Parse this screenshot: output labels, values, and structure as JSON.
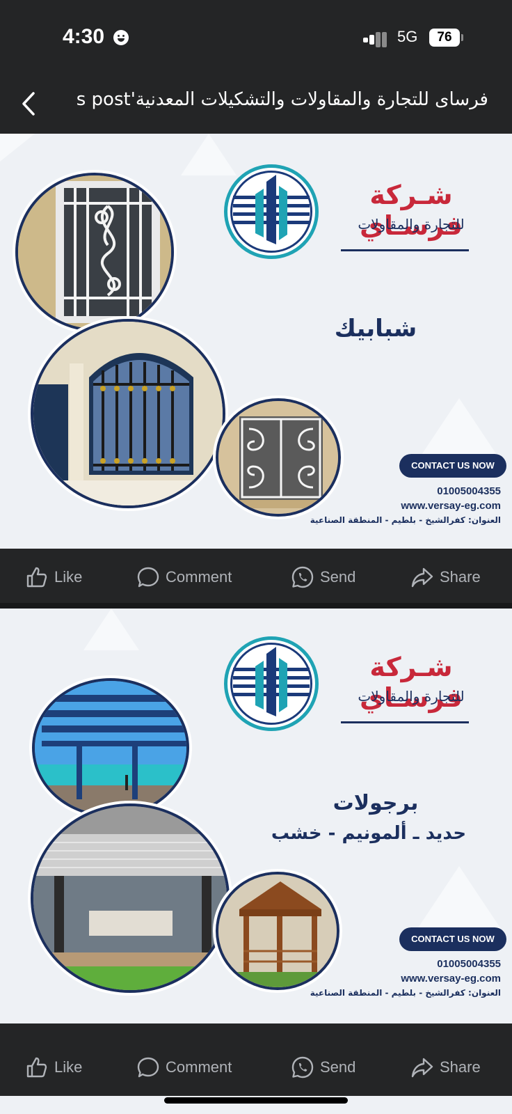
{
  "status_bar": {
    "time": "4:30",
    "network": "5G",
    "battery": "76"
  },
  "nav": {
    "title": "فرساى للتجارة والمقاولات والتشكيلات المعدنية's post"
  },
  "posts": [
    {
      "company_name": "شـركة فرسـاي",
      "company_sub": "للتجارة والمقاولات",
      "headline": "شبابيك",
      "subheadline": "",
      "contact_label": "CONTACT US NOW",
      "phone": "01005004355",
      "website": "www.versay-eg.com",
      "address": "العنوان: كفرالشيخ - بلطيم - المنطقة الصناعية",
      "photos": [
        "ornate-white-window-grill-icon",
        "arched-window-gold-spikes-icon",
        "scroll-window-grill-icon"
      ]
    },
    {
      "company_name": "شـركة فرسـاي",
      "company_sub": "للتجارة والمقاولات",
      "headline": "برجولات",
      "subheadline": "حديد ـ ألمونيم - خشب",
      "contact_label": "CONTACT US NOW",
      "phone": "01005004355",
      "website": "www.versay-eg.com",
      "address": "العنوان: كفرالشيخ - بلطيم - المنطقة الصناعية",
      "photos": [
        "beach-pergola-icon",
        "louvered-pergola-patio-icon",
        "wooden-gazebo-icon"
      ]
    }
  ],
  "actions": {
    "like": "Like",
    "comment": "Comment",
    "send": "Send",
    "share": "Share"
  },
  "colors": {
    "brand_navy": "#1b2f5e",
    "brand_teal": "#1fa3b4",
    "brand_red": "#c8283a",
    "ui_dark": "#242526"
  }
}
